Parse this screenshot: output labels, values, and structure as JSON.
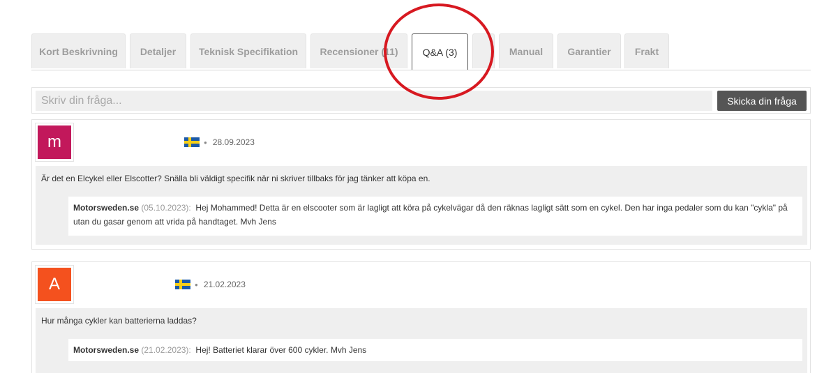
{
  "tabs": [
    {
      "label": "Kort Beskrivning",
      "active": false
    },
    {
      "label": "Detaljer",
      "active": false
    },
    {
      "label": "Teknisk Specifikation",
      "active": false
    },
    {
      "label": "Recensioner (11)",
      "active": false
    },
    {
      "label": "Q&A (3)",
      "active": true
    },
    {
      "label": "",
      "active": false
    },
    {
      "label": "Manual",
      "active": false
    },
    {
      "label": "Garantier",
      "active": false
    },
    {
      "label": "Frakt",
      "active": false
    }
  ],
  "ask": {
    "placeholder": "Skriv din fråga...",
    "button_label": "Skicka din fråga"
  },
  "questions": [
    {
      "avatar_letter": "m",
      "avatar_color": "#c2185b",
      "flag": "sweden-flag-icon",
      "date": "28.09.2023",
      "question": "Är det en Elcykel eller Elscotter? Snälla bli väldigt specifik när ni skriver tillbaks för jag tänker att köpa en.",
      "answer": {
        "author": "Motorsweden.se",
        "date": " (05.10.2023):",
        "text": "Hej Mohammed! Detta är en elscooter som är lagligt att köra på cykelvägar då den räknas lagligt sätt som en cykel. Den har inga pedaler som du kan \"cykla\" på utan du gasar genom att vrida på handtaget. Mvh Jens"
      }
    },
    {
      "avatar_letter": "A",
      "avatar_color": "#f4511e",
      "flag": "sweden-flag-icon",
      "date": "21.02.2023",
      "question": "Hur många cykler kan batterierna laddas?",
      "answer": {
        "author": "Motorsweden.se",
        "date": " (21.02.2023):",
        "text": "Hej! Batteriet klarar över 600 cykler. Mvh Jens"
      }
    }
  ],
  "annotation_color": "#d71921"
}
